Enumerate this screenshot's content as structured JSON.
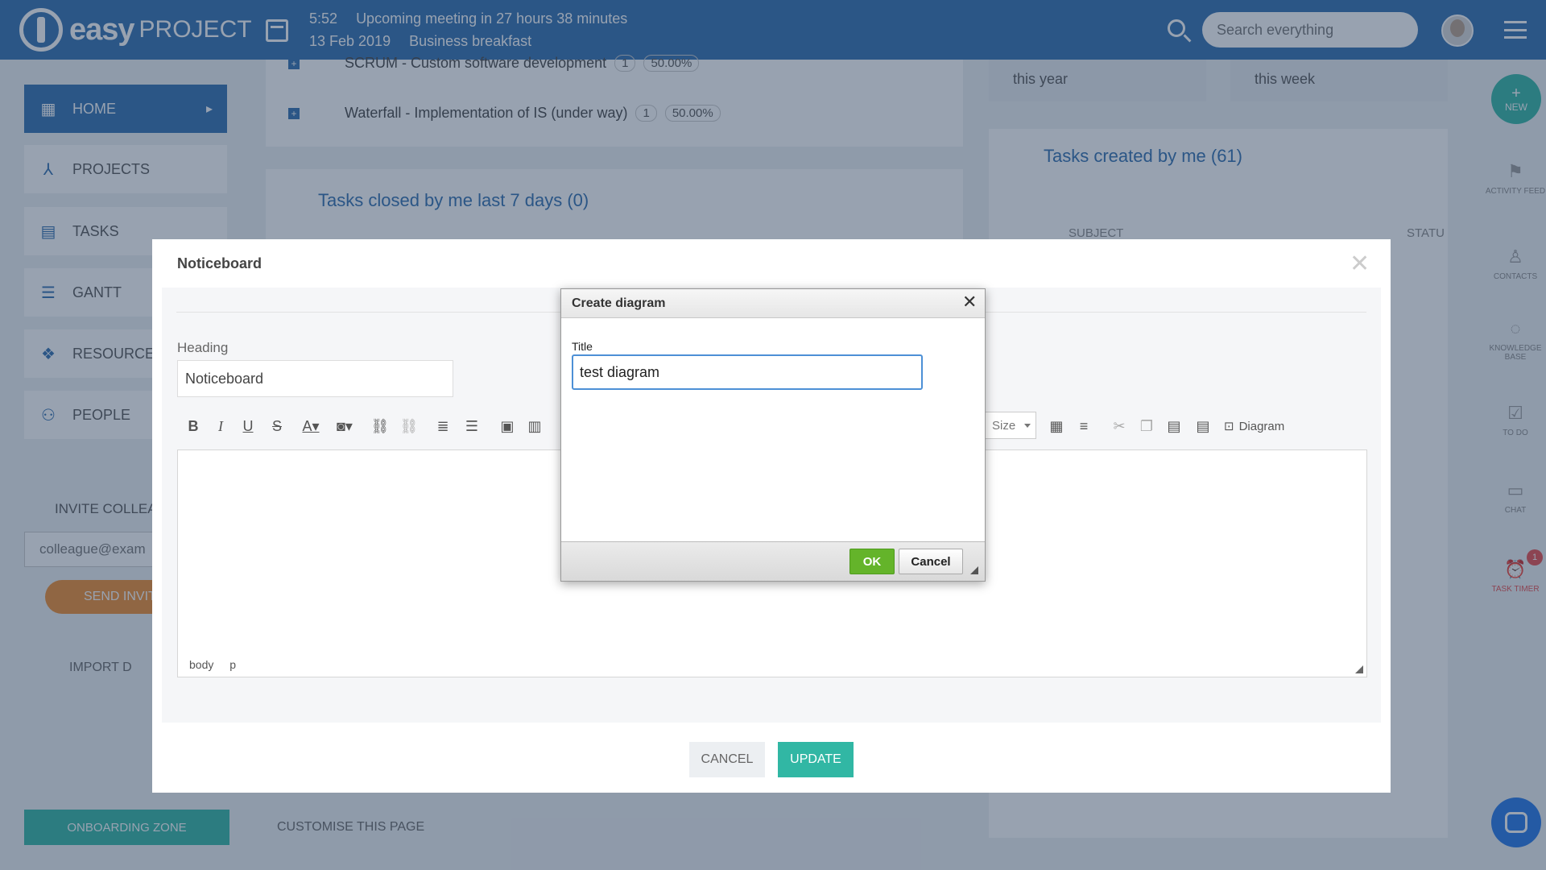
{
  "topbar": {
    "logo_bold": "easy",
    "logo_light": "PROJECT",
    "meeting_time": "5:52",
    "meeting_text": "Upcoming meeting in 27 hours 38 minutes",
    "meeting_date": "13 Feb 2019",
    "meeting_name": "Business breakfast",
    "search_placeholder": "Search everything"
  },
  "sidebar": {
    "items": [
      {
        "label": "HOME",
        "icon": "dashboard-icon"
      },
      {
        "label": "PROJECTS",
        "icon": "projects-icon"
      },
      {
        "label": "TASKS",
        "icon": "clipboard-icon"
      },
      {
        "label": "GANTT",
        "icon": "gantt-icon"
      },
      {
        "label": "RESOURCE",
        "icon": "dropbox-icon"
      },
      {
        "label": "PEOPLE",
        "icon": "people-icon"
      }
    ],
    "invite_title": "INVITE COLLEA",
    "invite_placeholder": "colleague@exam",
    "send_label": "SEND INVIT",
    "import_label": "IMPORT D",
    "onboarding_label": "ONBOARDING ZONE",
    "customise_label": "CUSTOMISE THIS PAGE"
  },
  "background": {
    "projects": [
      {
        "name": "SCRUM - Custom software development",
        "count": "1",
        "percent": "50.00%"
      },
      {
        "name": "Waterfall - Implementation of IS (under way)",
        "count": "1",
        "percent": "50.00%"
      }
    ],
    "tasks_closed_title": "Tasks closed by me last 7 days (0)",
    "tab_year": "this year",
    "tab_week": "this week",
    "tasks_created_title": "Tasks created by me (61)",
    "col_subject": "SUBJECT",
    "col_status": "STATU"
  },
  "rail": {
    "new_label": "NEW",
    "items": [
      {
        "label": "ACTIVITY FEED",
        "icon": "flag-icon"
      },
      {
        "label": "CONTACTS",
        "icon": "contact-icon"
      },
      {
        "label": "KNOWLEDGE BASE",
        "icon": "bulb-icon"
      },
      {
        "label": "TO DO",
        "icon": "checkbox-icon"
      },
      {
        "label": "CHAT",
        "icon": "chat-icon"
      },
      {
        "label": "TASK TIMER",
        "icon": "alarm-icon"
      }
    ],
    "timer_badge": "1"
  },
  "modal": {
    "title": "Noticeboard",
    "heading_label": "Heading",
    "heading_value": "Noticeboard",
    "size_label": "Size",
    "diagram_label": "Diagram",
    "path_body": "body",
    "path_p": "p",
    "cancel_label": "CANCEL",
    "update_label": "UPDATE"
  },
  "dialog": {
    "title": "Create diagram",
    "title_label": "Title",
    "title_value": "test diagram",
    "ok_label": "OK",
    "cancel_label": "Cancel"
  },
  "colors": {
    "brand_blue": "#2f6dae",
    "accent_teal": "#31b7a4",
    "ok_green": "#64b42a",
    "alert_red": "#e94c4c"
  }
}
